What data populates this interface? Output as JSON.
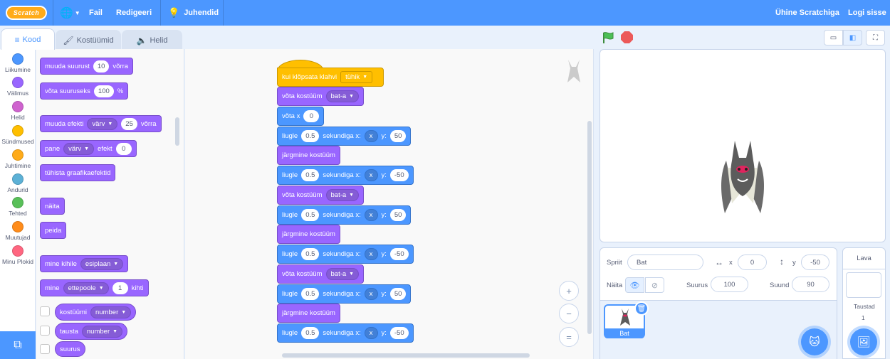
{
  "menubar": {
    "logo": "Scratch",
    "file": "Fail",
    "edit": "Redigeeri",
    "tutorials": "Juhendid",
    "join": "Ühine Scratchiga",
    "signin": "Logi sisse"
  },
  "tabs": {
    "code": "Kood",
    "costumes": "Kostüümid",
    "sounds": "Helid"
  },
  "categories": [
    {
      "label": "Liikumine",
      "color": "#4c97ff"
    },
    {
      "label": "Välimus",
      "color": "#9966ff"
    },
    {
      "label": "Helid",
      "color": "#cf63cf"
    },
    {
      "label": "Sündmused",
      "color": "#ffbf00"
    },
    {
      "label": "Juhtimine",
      "color": "#ffab19"
    },
    {
      "label": "Andurid",
      "color": "#5cb1d6"
    },
    {
      "label": "Tehted",
      "color": "#59c059"
    },
    {
      "label": "Muutujad",
      "color": "#ff8c1a"
    },
    {
      "label": "Minu Plokid",
      "color": "#ff6680"
    }
  ],
  "palette": {
    "change_size": {
      "a": "muuda suurust",
      "v": "10",
      "b": "võrra"
    },
    "set_size": {
      "a": "võta suuruseks",
      "v": "100",
      "b": "%"
    },
    "change_effect": {
      "a": "muuda efekti",
      "d": "värv",
      "v": "25",
      "b": "võrra"
    },
    "set_effect": {
      "a": "pane",
      "d": "värv",
      "b": "efekt",
      "v": "0"
    },
    "clear_effects": "tühista graafikaefektid",
    "show": "näita",
    "hide": "peida",
    "go_to_layer": {
      "a": "mine kihile",
      "d": "esiplaan"
    },
    "go_layers": {
      "a": "mine",
      "d": "ettepoole",
      "v": "1",
      "b": "kihti"
    },
    "costume_number": {
      "a": "kostüümi",
      "d": "number"
    },
    "backdrop_number": {
      "a": "tausta",
      "d": "number"
    },
    "size": "suurus"
  },
  "script": {
    "hat": {
      "a": "kui klõpsata klahvi",
      "d": "tühik"
    },
    "switch_label": "võta kostüüm",
    "costume": "bat-a",
    "setx": {
      "a": "võta x",
      "v": "0"
    },
    "glide": {
      "a": "liugle",
      "t": "0.5",
      "b": "sekundiga x:",
      "x": "x",
      "y": "y:"
    },
    "next": "järgmine kostüüm",
    "y_pos": "50",
    "y_neg": "-50"
  },
  "stage_controls": {
    "zoom_in": "+",
    "zoom_out": "−",
    "reset": "="
  },
  "sprite_info": {
    "sprite_label": "Spriit",
    "sprite_name": "Bat",
    "x_label": "x",
    "x_value": "0",
    "y_label": "y",
    "y_value": "-50",
    "show_label": "Näita",
    "size_label": "Suurus",
    "size_value": "100",
    "direction_label": "Suund",
    "direction_value": "90"
  },
  "sprite_list": [
    {
      "name": "Bat"
    }
  ],
  "stage_pane": {
    "title": "Lava",
    "backdrops_label": "Taustad",
    "backdrops_count": "1"
  }
}
